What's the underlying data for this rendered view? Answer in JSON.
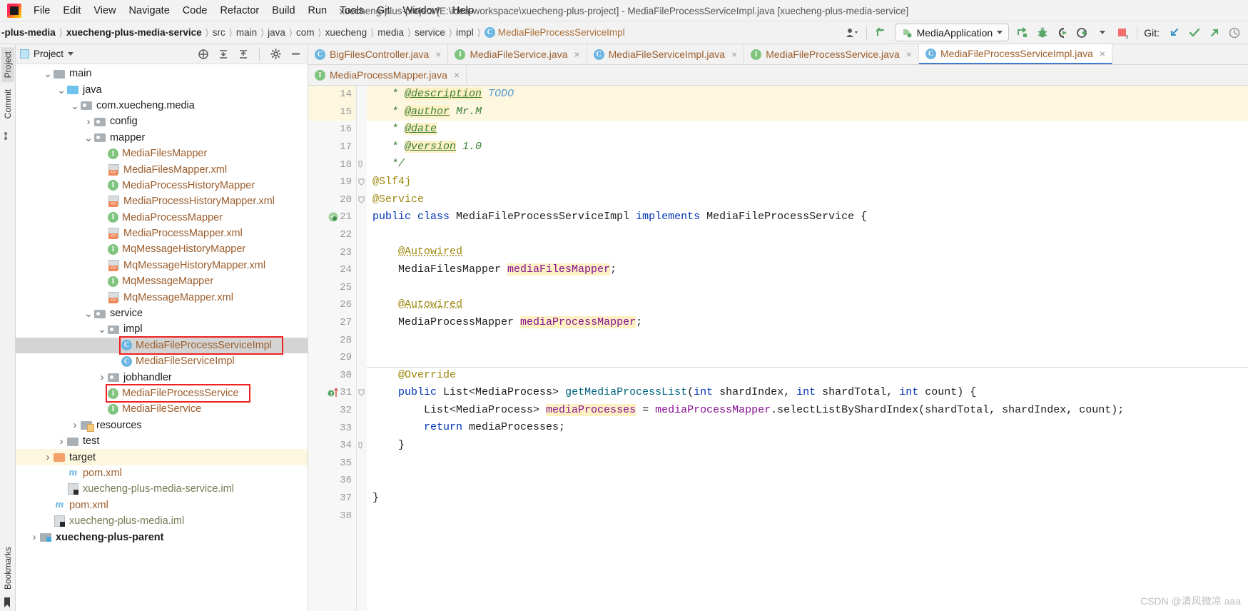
{
  "window": {
    "title": "xuecheng-plus-project [E:\\idea-workspace\\xuecheng-plus-project] - MediaFileProcessServiceImpl.java [xuecheng-plus-media-service]"
  },
  "menubar": {
    "items": [
      "File",
      "Edit",
      "View",
      "Navigate",
      "Code",
      "Refactor",
      "Build",
      "Run",
      "Tools",
      "Git",
      "Window",
      "Help"
    ]
  },
  "navbar": {
    "crumbs": [
      {
        "label": "-plus-media",
        "bold": true
      },
      {
        "label": "xuecheng-plus-media-service",
        "bold": true
      },
      {
        "label": "src",
        "bold": false
      },
      {
        "label": "main",
        "bold": false
      },
      {
        "label": "java",
        "bold": false
      },
      {
        "label": "com",
        "bold": false
      },
      {
        "label": "xuecheng",
        "bold": false
      },
      {
        "label": "media",
        "bold": false
      },
      {
        "label": "service",
        "bold": false
      },
      {
        "label": "impl",
        "bold": false
      }
    ],
    "current_class": "MediaFileProcessServiceImpl",
    "run_config": "MediaApplication",
    "git_label": "Git:",
    "separator": "❯"
  },
  "project_panel": {
    "title": "Project",
    "vertical_tabs": [
      "Project",
      "Commit",
      "Bookmarks"
    ],
    "tree": [
      {
        "indent": 3,
        "arrow": "down",
        "icon": "folder-plain",
        "label": "main",
        "style": "plain"
      },
      {
        "indent": 4,
        "arrow": "down",
        "icon": "folder-src",
        "label": "java",
        "style": "plain"
      },
      {
        "indent": 5,
        "arrow": "down",
        "icon": "folder-pkg",
        "label": "com.xuecheng.media",
        "style": "plain"
      },
      {
        "indent": 6,
        "arrow": "right",
        "icon": "folder-pkg",
        "label": "config",
        "style": "plain"
      },
      {
        "indent": 6,
        "arrow": "down",
        "icon": "folder-pkg",
        "label": "mapper",
        "style": "plain"
      },
      {
        "indent": 7,
        "arrow": "none",
        "icon": "interface",
        "label": "MediaFilesMapper",
        "style": "file"
      },
      {
        "indent": 7,
        "arrow": "none",
        "icon": "xml",
        "label": "MediaFilesMapper.xml",
        "style": "file"
      },
      {
        "indent": 7,
        "arrow": "none",
        "icon": "interface",
        "label": "MediaProcessHistoryMapper",
        "style": "file"
      },
      {
        "indent": 7,
        "arrow": "none",
        "icon": "xml",
        "label": "MediaProcessHistoryMapper.xml",
        "style": "file"
      },
      {
        "indent": 7,
        "arrow": "none",
        "icon": "interface",
        "label": "MediaProcessMapper",
        "style": "file"
      },
      {
        "indent": 7,
        "arrow": "none",
        "icon": "xml",
        "label": "MediaProcessMapper.xml",
        "style": "file"
      },
      {
        "indent": 7,
        "arrow": "none",
        "icon": "interface",
        "label": "MqMessageHistoryMapper",
        "style": "file"
      },
      {
        "indent": 7,
        "arrow": "none",
        "icon": "xml",
        "label": "MqMessageHistoryMapper.xml",
        "style": "file"
      },
      {
        "indent": 7,
        "arrow": "none",
        "icon": "interface",
        "label": "MqMessageMapper",
        "style": "file"
      },
      {
        "indent": 7,
        "arrow": "none",
        "icon": "xml",
        "label": "MqMessageMapper.xml",
        "style": "file"
      },
      {
        "indent": 6,
        "arrow": "down",
        "icon": "folder-pkg",
        "label": "service",
        "style": "plain"
      },
      {
        "indent": 7,
        "arrow": "down",
        "icon": "folder-pkg",
        "label": "impl",
        "style": "plain"
      },
      {
        "indent": 8,
        "arrow": "none",
        "icon": "class",
        "label": "MediaFileProcessServiceImpl",
        "style": "file",
        "selected": true,
        "boxed": true
      },
      {
        "indent": 8,
        "arrow": "none",
        "icon": "class",
        "label": "MediaFileServiceImpl",
        "style": "file"
      },
      {
        "indent": 7,
        "arrow": "right",
        "icon": "folder-pkg",
        "label": "jobhandler",
        "style": "plain"
      },
      {
        "indent": 7,
        "arrow": "none",
        "icon": "interface",
        "label": "MediaFileProcessService",
        "style": "file",
        "boxed": true
      },
      {
        "indent": 7,
        "arrow": "none",
        "icon": "interface",
        "label": "MediaFileService",
        "style": "file"
      },
      {
        "indent": 5,
        "arrow": "right",
        "icon": "folder-res",
        "label": "resources",
        "style": "plain"
      },
      {
        "indent": 4,
        "arrow": "right",
        "icon": "folder-plain",
        "label": "test",
        "style": "plain"
      },
      {
        "indent": 3,
        "arrow": "right",
        "icon": "folder-target",
        "label": "target",
        "style": "plain",
        "highlighted": true
      },
      {
        "indent": 4,
        "arrow": "none",
        "icon": "maven",
        "label": "pom.xml",
        "style": "file"
      },
      {
        "indent": 4,
        "arrow": "none",
        "icon": "iml",
        "label": "xuecheng-plus-media-service.iml",
        "style": "iml"
      },
      {
        "indent": 3,
        "arrow": "none",
        "icon": "maven",
        "label": "pom.xml",
        "style": "file"
      },
      {
        "indent": 3,
        "arrow": "none",
        "icon": "iml",
        "label": "xuecheng-plus-media.iml",
        "style": "iml"
      },
      {
        "indent": 2,
        "arrow": "right",
        "icon": "folder-mod",
        "label": "xuecheng-plus-parent",
        "style": "plain",
        "bold": true
      }
    ]
  },
  "editor": {
    "tabs_row1": [
      {
        "label": "BigFilesController.java",
        "icon": "class",
        "active": false
      },
      {
        "label": "MediaFileService.java",
        "icon": "interface",
        "active": false
      },
      {
        "label": "MediaFileServiceImpl.java",
        "icon": "class",
        "active": false
      },
      {
        "label": "MediaFileProcessService.java",
        "icon": "interface",
        "active": false
      },
      {
        "label": "MediaFileProcessServiceImpl.java",
        "icon": "class",
        "active": true
      }
    ],
    "tabs_row2": [
      {
        "label": "MediaProcessMapper.java",
        "icon": "interface",
        "active": false
      }
    ],
    "first_line_number": 14,
    "lines": [
      {
        "n": 14,
        "highlight": true,
        "segments": [
          {
            "t": "   * ",
            "c": "cmt"
          },
          {
            "t": "@description",
            "c": "tag"
          },
          {
            "t": " ",
            "c": "cmt"
          },
          {
            "t": "TODO",
            "c": "tagv"
          }
        ]
      },
      {
        "n": 15,
        "highlight": true,
        "segments": [
          {
            "t": "   * ",
            "c": "cmt"
          },
          {
            "t": "@author",
            "c": "tag"
          },
          {
            "t": " Mr.M",
            "c": "cmt"
          }
        ]
      },
      {
        "n": 16,
        "highlight": false,
        "segments": [
          {
            "t": "   * ",
            "c": "cmt"
          },
          {
            "t": "@date",
            "c": "tag"
          }
        ]
      },
      {
        "n": 17,
        "highlight": false,
        "segments": [
          {
            "t": "   * ",
            "c": "cmt"
          },
          {
            "t": "@version",
            "c": "tag"
          },
          {
            "t": " 1.0",
            "c": "cmt"
          }
        ]
      },
      {
        "n": 18,
        "highlight": false,
        "segments": [
          {
            "t": "   */",
            "c": "cmt"
          }
        ]
      },
      {
        "n": 19,
        "highlight": false,
        "segments": [
          {
            "t": "@Slf4j",
            "c": "anno"
          }
        ]
      },
      {
        "n": 20,
        "highlight": false,
        "segments": [
          {
            "t": "@Service",
            "c": "anno"
          }
        ]
      },
      {
        "n": 21,
        "highlight": false,
        "segments": [
          {
            "t": "public class",
            "c": "kw"
          },
          {
            "t": " MediaFileProcessServiceImpl ",
            "c": "plain"
          },
          {
            "t": "implements",
            "c": "kw"
          },
          {
            "t": " MediaFileProcessService {",
            "c": "plain"
          }
        ]
      },
      {
        "n": 22,
        "highlight": false,
        "segments": []
      },
      {
        "n": 23,
        "highlight": false,
        "segments": [
          {
            "t": "    ",
            "c": "plain"
          },
          {
            "t": "@Autowired",
            "c": "annou"
          }
        ]
      },
      {
        "n": 24,
        "highlight": false,
        "segments": [
          {
            "t": "    MediaFilesMapper ",
            "c": "plain"
          },
          {
            "t": "mediaFilesMapper",
            "c": "fld"
          },
          {
            "t": ";",
            "c": "plain"
          }
        ]
      },
      {
        "n": 25,
        "highlight": false,
        "segments": []
      },
      {
        "n": 26,
        "highlight": false,
        "segments": [
          {
            "t": "    ",
            "c": "plain"
          },
          {
            "t": "@Autowired",
            "c": "annou"
          }
        ]
      },
      {
        "n": 27,
        "highlight": false,
        "segments": [
          {
            "t": "    MediaProcessMapper ",
            "c": "plain"
          },
          {
            "t": "mediaProcessMapper",
            "c": "fld"
          },
          {
            "t": ";",
            "c": "plain"
          }
        ]
      },
      {
        "n": 28,
        "highlight": false,
        "segments": []
      },
      {
        "n": 29,
        "highlight": false,
        "segments": []
      },
      {
        "n": 30,
        "highlight": false,
        "segments": [
          {
            "t": "    ",
            "c": "plain"
          },
          {
            "t": "@Override",
            "c": "anno"
          }
        ]
      },
      {
        "n": 31,
        "highlight": false,
        "segments": [
          {
            "t": "    ",
            "c": "plain"
          },
          {
            "t": "public",
            "c": "kw"
          },
          {
            "t": " List<MediaProcess> ",
            "c": "plain"
          },
          {
            "t": "getMediaProcessList",
            "c": "mth"
          },
          {
            "t": "(",
            "c": "plain"
          },
          {
            "t": "int",
            "c": "kw"
          },
          {
            "t": " shardIndex, ",
            "c": "plain"
          },
          {
            "t": "int",
            "c": "kw"
          },
          {
            "t": " shardTotal, ",
            "c": "plain"
          },
          {
            "t": "int",
            "c": "kw"
          },
          {
            "t": " count) {",
            "c": "plain"
          }
        ]
      },
      {
        "n": 32,
        "highlight": false,
        "segments": [
          {
            "t": "        List<MediaProcess> ",
            "c": "plain"
          },
          {
            "t": "mediaProcesses",
            "c": "var"
          },
          {
            "t": " = ",
            "c": "plain"
          },
          {
            "t": "mediaProcessMapper",
            "c": "fldp"
          },
          {
            "t": ".selectListByShardIndex(shardTotal, shardIndex, count);",
            "c": "plain"
          }
        ]
      },
      {
        "n": 33,
        "highlight": false,
        "segments": [
          {
            "t": "        ",
            "c": "plain"
          },
          {
            "t": "return",
            "c": "kw"
          },
          {
            "t": " mediaProcesses;",
            "c": "plain"
          }
        ]
      },
      {
        "n": 34,
        "highlight": false,
        "segments": [
          {
            "t": "    }",
            "c": "plain"
          }
        ]
      },
      {
        "n": 35,
        "highlight": false,
        "segments": []
      },
      {
        "n": 36,
        "highlight": false,
        "segments": []
      },
      {
        "n": 37,
        "highlight": false,
        "segments": [
          {
            "t": "}",
            "c": "plain"
          }
        ]
      },
      {
        "n": 38,
        "highlight": false,
        "segments": []
      }
    ]
  },
  "watermark": "CSDN @清风微凉 aaa",
  "colors": {
    "accent_blue": "#3d7dcc",
    "class_icon": "#6cb6e3",
    "interface_icon": "#7fc47f",
    "filename": "#9c5d2b",
    "annotation_box": "#ee2222",
    "highlight_row": "#fdf7df",
    "selection": "#d4d4d4"
  }
}
